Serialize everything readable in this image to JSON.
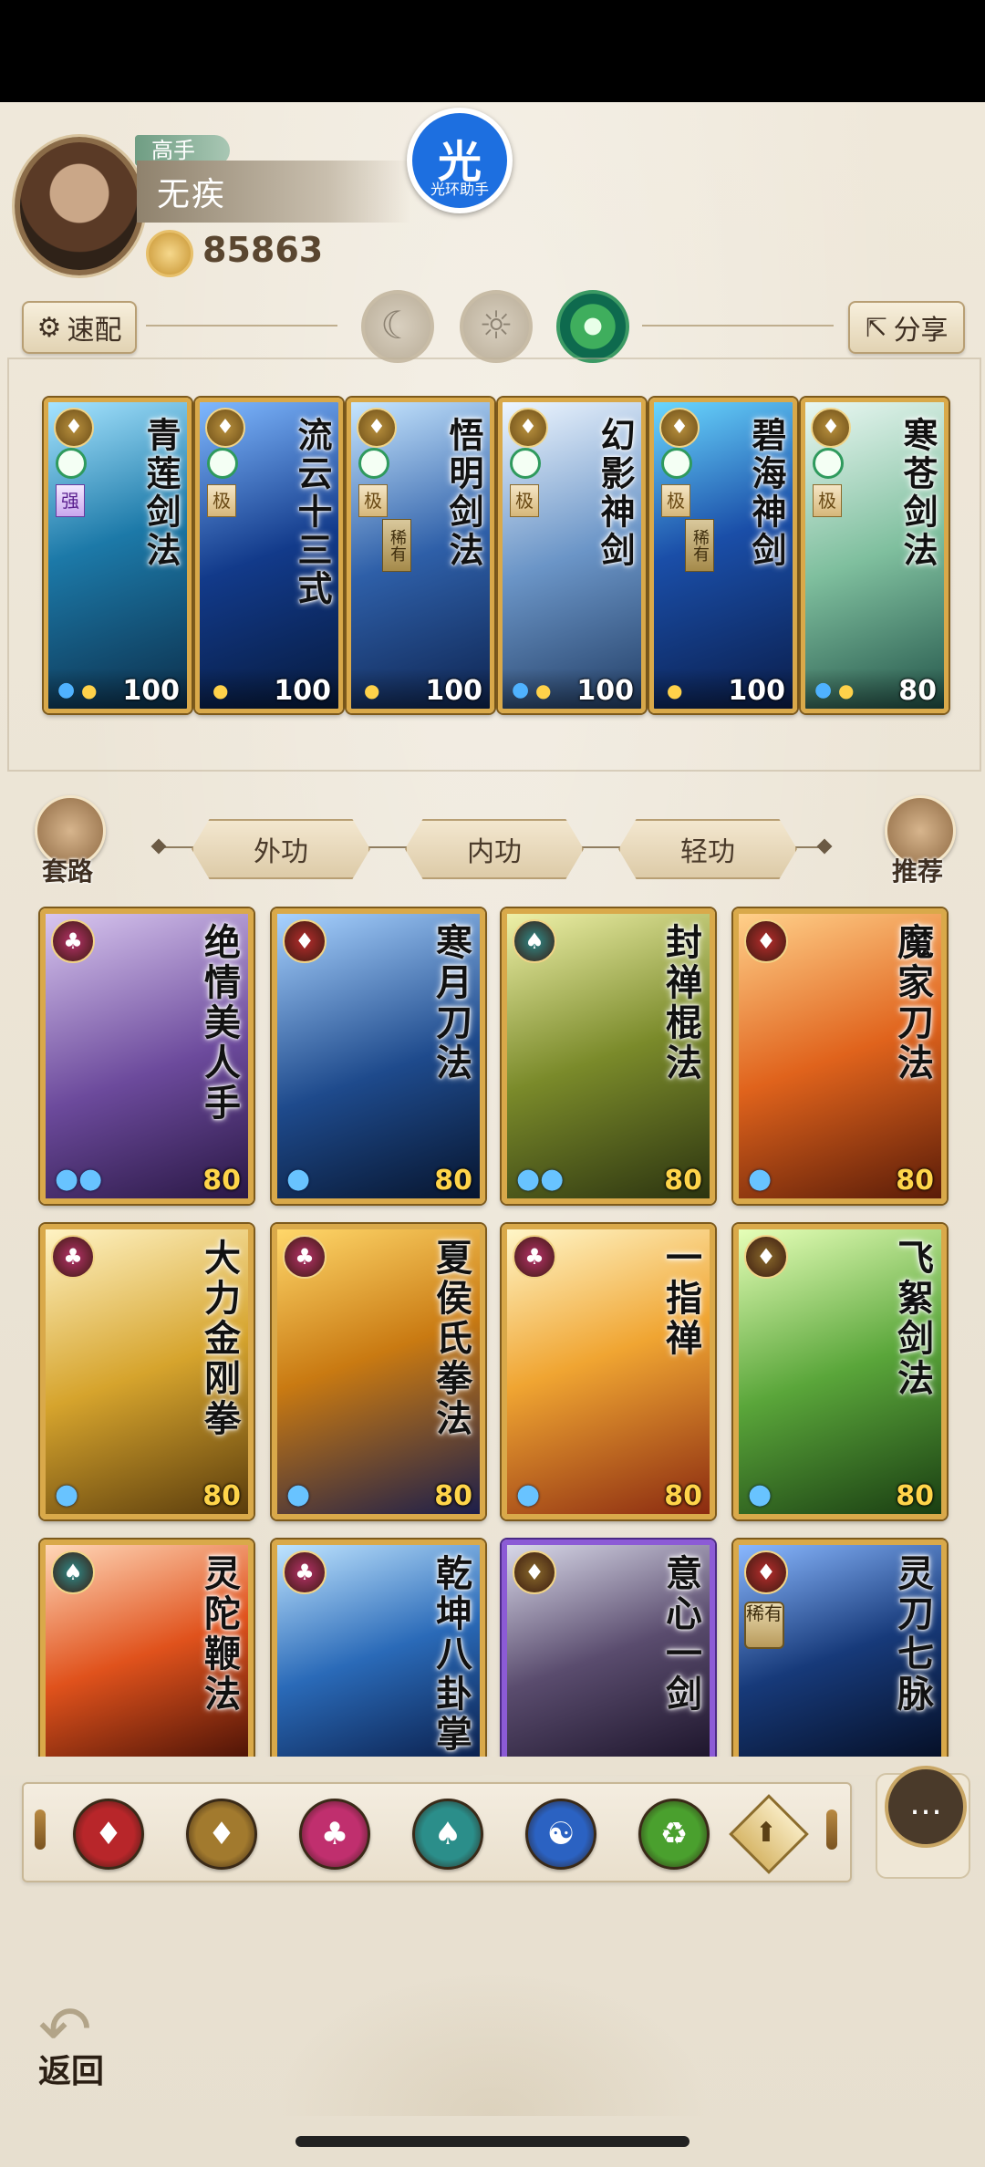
{
  "profile": {
    "rank_label": "高手",
    "name": "无疾",
    "power": "85863",
    "halo_glyph": "光",
    "halo_label": "光环助手"
  },
  "toolbar": {
    "quick_label": "速配",
    "share_label": "分享"
  },
  "modes": [
    "moon",
    "sun",
    "crescent"
  ],
  "equipped": [
    {
      "title": "青莲剑法",
      "grade": "强",
      "grade_style": "strong",
      "rare": "",
      "level": "100",
      "drops": 1,
      "gourd": true,
      "art": "linear-gradient(160deg,#a6e4ff,#1c79a8 45%,#0c2e4a)"
    },
    {
      "title": "流云十三式",
      "grade": "极",
      "grade_style": "",
      "rare": "",
      "level": "100",
      "drops": 0,
      "gourd": true,
      "art": "linear-gradient(160deg,#7fb8ff,#123a8a 50%,#071a3d)"
    },
    {
      "title": "悟明剑法",
      "grade": "极",
      "grade_style": "",
      "rare": "稀有",
      "level": "100",
      "drops": 0,
      "gourd": true,
      "art": "linear-gradient(160deg,#c7e6ff,#2e5fa8 50%,#0e2450)"
    },
    {
      "title": "幻影神剑",
      "grade": "极",
      "grade_style": "",
      "rare": "",
      "level": "100",
      "drops": 1,
      "gourd": true,
      "art": "linear-gradient(160deg,#eef6ff,#6b95c7 50%,#223e66)"
    },
    {
      "title": "碧海神剑",
      "grade": "极",
      "grade_style": "",
      "rare": "稀有",
      "level": "100",
      "drops": 0,
      "gourd": true,
      "art": "linear-gradient(160deg,#6ad7ff,#1a4ea8 45%,#0a1d4a)"
    },
    {
      "title": "寒苍剑法",
      "grade": "极",
      "grade_style": "",
      "rare": "",
      "level": "80",
      "drops": 1,
      "gourd": true,
      "art": "linear-gradient(160deg,#e9f7f2,#7fbf9e 50%,#23554a)"
    }
  ],
  "side_left_label": "套路",
  "side_right_label": "推荐",
  "tabs": [
    {
      "label": "外功",
      "active": true
    },
    {
      "label": "内功",
      "active": false
    },
    {
      "label": "轻功",
      "active": false
    }
  ],
  "skills": [
    {
      "title": "绝情美人手",
      "type": "♣",
      "type_color": "#b8326a",
      "rare": "",
      "level": "80",
      "drops": "99",
      "frame": "gold",
      "art": "linear-gradient(160deg,#d8c6ef,#6c4a9c 55%,#2a1845)"
    },
    {
      "title": "寒月刀法",
      "type": "♦",
      "type_color": "#b82d2d",
      "rare": "",
      "level": "80",
      "drops": "9",
      "frame": "gold",
      "art": "linear-gradient(160deg,#a8d2ff,#1e4a8c 55%,#07152e)"
    },
    {
      "title": "封禅棍法",
      "type": "♠",
      "type_color": "#2f8c8a",
      "rare": "",
      "level": "80",
      "drops": "99",
      "frame": "gold",
      "art": "linear-gradient(160deg,#eef0a8,#7a8a2a 50%,#2c3410)"
    },
    {
      "title": "魔家刀法",
      "type": "♦",
      "type_color": "#b82d2d",
      "rare": "",
      "level": "80",
      "drops": "9",
      "frame": "gold",
      "art": "linear-gradient(160deg,#ffd08a,#e0631c 50%,#5a1c08)"
    },
    {
      "title": "大力金刚拳",
      "type": "♣",
      "type_color": "#b8326a",
      "rare": "",
      "level": "80",
      "drops": "9",
      "frame": "gold",
      "art": "linear-gradient(160deg,#fff3c4,#d6a42d 50%,#5a3c0c)"
    },
    {
      "title": "夏侯氏拳法",
      "type": "♣",
      "type_color": "#b8326a",
      "rare": "",
      "level": "80",
      "drops": "9",
      "frame": "gold",
      "art": "linear-gradient(160deg,#ffd76a,#c97a12 45%,#1c1e4a)"
    },
    {
      "title": "一指禅",
      "type": "♣",
      "type_color": "#b8326a",
      "rare": "",
      "level": "80",
      "drops": "9",
      "frame": "gold",
      "art": "linear-gradient(160deg,#fff6c8,#f0a532 45%,#8a2a10)"
    },
    {
      "title": "飞絮剑法",
      "type": "♦",
      "type_color": "#8a6a2b",
      "rare": "",
      "level": "80",
      "drops": "9",
      "frame": "gold",
      "art": "linear-gradient(160deg,#e6ffb8,#5aa63a 50%,#1a3e12)"
    },
    {
      "title": "灵陀鞭法",
      "type": "♠",
      "type_color": "#2f8c8a",
      "rare": "",
      "level": "",
      "drops": "",
      "frame": "gold",
      "art": "linear-gradient(160deg,#ffd7b8,#e0521c 50%,#4a1206)"
    },
    {
      "title": "乾坤八卦掌",
      "type": "♣",
      "type_color": "#b8326a",
      "rare": "",
      "level": "",
      "drops": "",
      "frame": "gold",
      "art": "linear-gradient(160deg,#bfe4ff,#2a6ab8 50%,#0a1e4a)"
    },
    {
      "title": "意心一剑",
      "type": "♦",
      "type_color": "#8a6a2b",
      "rare": "",
      "level": "",
      "drops": "",
      "frame": "purple",
      "art": "linear-gradient(160deg,#d8d8e8,#5a4c6e 50%,#1c142a)"
    },
    {
      "title": "灵刀七脉",
      "type": "♦",
      "type_color": "#b82d2d",
      "rare": "稀有",
      "level": "",
      "drops": "",
      "frame": "gold",
      "art": "linear-gradient(160deg,#8ab8ff,#173a7a 50%,#050e24)"
    }
  ],
  "filters": [
    {
      "name": "blade-filter-icon",
      "glyph": "♦",
      "color": "#b8262a"
    },
    {
      "name": "sword-filter-icon",
      "glyph": "♦",
      "color": "#a27a2e"
    },
    {
      "name": "fist-filter-icon",
      "glyph": "♣",
      "color": "#c02f6e"
    },
    {
      "name": "staff-filter-icon",
      "glyph": "♠",
      "color": "#2b8e8a"
    },
    {
      "name": "taiji-filter-icon",
      "glyph": "☯",
      "color": "#2b62c2"
    },
    {
      "name": "whip-filter-icon",
      "glyph": "♻",
      "color": "#4aa02e"
    }
  ],
  "filter_extra_glyph": "⬆",
  "chat_glyph": "…",
  "back_arrow": "↶",
  "back_label": "返回"
}
